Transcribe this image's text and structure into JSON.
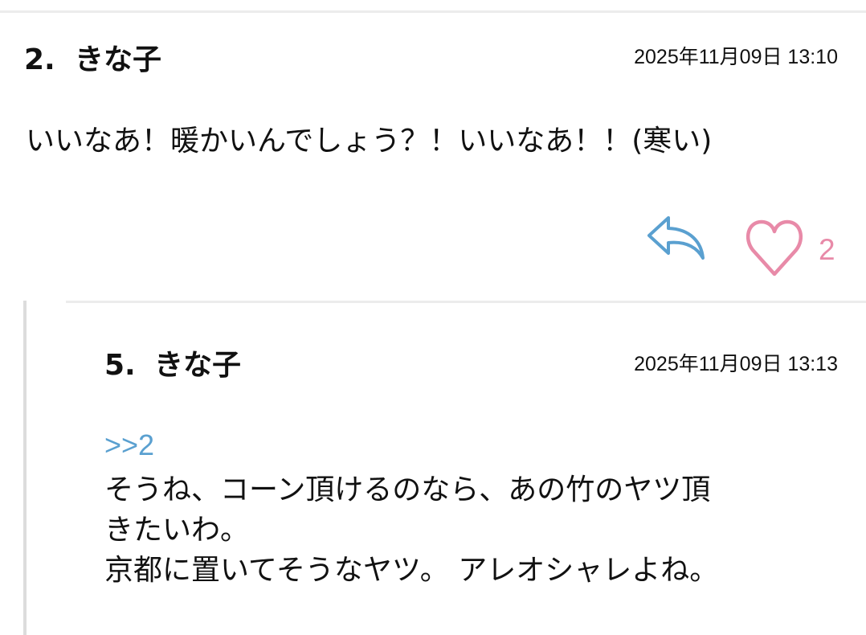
{
  "colors": {
    "reply_icon": "#5aa0d0",
    "like_icon": "#e88aa8",
    "anchor_link": "#5aa0d0",
    "divider": "#ececec",
    "thread_rule": "#dcdcdc"
  },
  "comments": [
    {
      "number": "2.",
      "author": "きな子",
      "timestamp": "2025年11月09日 13:10",
      "body": "いいなあ！暖かいんでしょう？！いいなあ！！(寒い)",
      "reply_icon": "reply-arrow-icon",
      "like_icon": "heart-outline-icon",
      "like_count": "2"
    }
  ],
  "replies": [
    {
      "number": "5.",
      "author": "きな子",
      "timestamp": "2025年11月09日 13:13",
      "anchor": ">>2",
      "body_lines": [
        "そうね、コーン頂けるのなら、あの竹のヤツ頂",
        "きたいわ。",
        "京都に置いてそうなヤツ。 アレオシャレよね。"
      ]
    }
  ]
}
